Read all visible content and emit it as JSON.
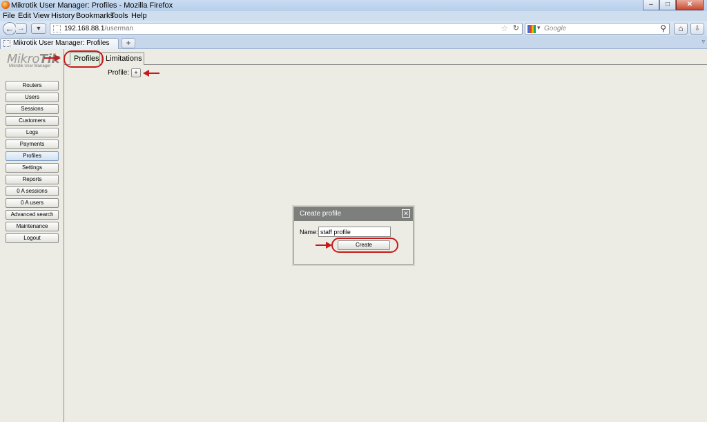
{
  "window": {
    "title": "Mikrotik User Manager: Profiles - Mozilla Firefox",
    "controls": {
      "minimize": "–",
      "maximize": "□",
      "close": "✕"
    }
  },
  "menubar": [
    "File",
    "Edit",
    "View",
    "History",
    "Bookmarks",
    "Tools",
    "Help"
  ],
  "navbar": {
    "url_host": "192.168.88.1",
    "url_path": "/userman",
    "search_engine": "Google"
  },
  "browser_tab": {
    "title": "Mikrotik User Manager: Profiles",
    "new_tab": "+"
  },
  "logo": {
    "brand_light": "Mikro",
    "brand_bold": "Tik",
    "subtitle": "Mikrotik User Manager"
  },
  "sidebar": {
    "items": [
      {
        "label": "Routers"
      },
      {
        "label": "Users"
      },
      {
        "label": "Sessions"
      },
      {
        "label": "Customers"
      },
      {
        "label": "Logs"
      },
      {
        "label": "Payments"
      },
      {
        "label": "Profiles",
        "active": true
      },
      {
        "label": "Settings"
      },
      {
        "label": "Reports"
      },
      {
        "label": "0 A sessions"
      },
      {
        "label": "0 A users"
      },
      {
        "label": "Advanced search"
      },
      {
        "label": "Maintenance"
      },
      {
        "label": "Logout"
      }
    ]
  },
  "tabs": [
    {
      "label": "Profiles",
      "active": true
    },
    {
      "label": "Limitations"
    }
  ],
  "profile_row": {
    "label": "Profile:",
    "add_button": "+"
  },
  "dialog": {
    "title": "Create profile",
    "close": "✕",
    "name_label": "Name:",
    "name_value": "staff profile",
    "create_button": "Create"
  },
  "colors": {
    "highlight": "#c41a1a",
    "page_bg": "#ecebe4",
    "dialog_header": "#7d7f7d"
  }
}
